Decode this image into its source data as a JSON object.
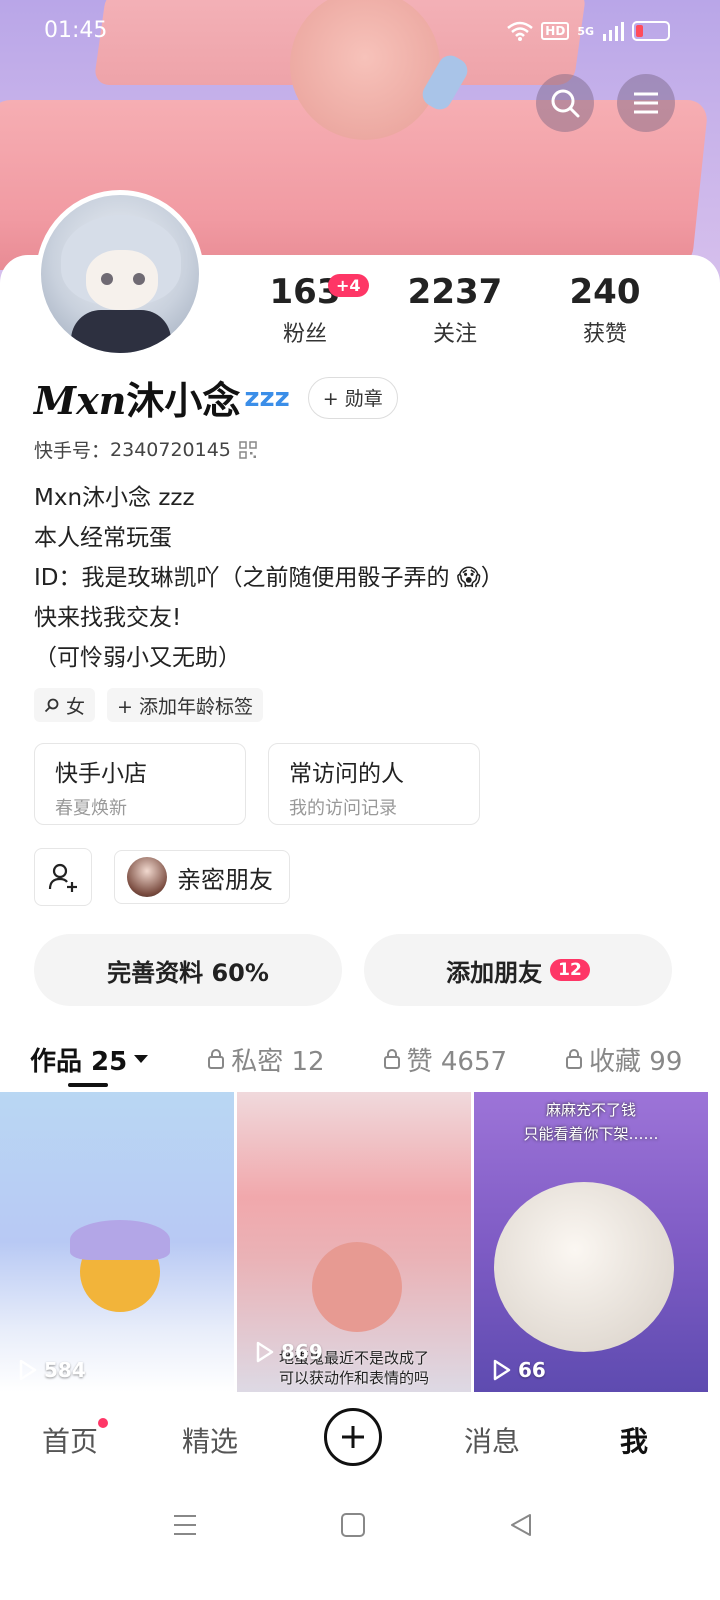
{
  "status_bar": {
    "time": "01:45",
    "hd": "HD",
    "network": "5G"
  },
  "profile": {
    "stats": [
      {
        "value": "163",
        "label": "粉丝",
        "badge": "+4"
      },
      {
        "value": "2237",
        "label": "关注"
      },
      {
        "value": "240",
        "label": "获赞"
      }
    ],
    "name_script": "Mxn",
    "name": "沐小念",
    "name_suffix": "zzz",
    "medal_button": "+ 勋章",
    "kuaishou_id_label": "快手号：",
    "kuaishou_id": "2340720145",
    "bio_lines": [
      "Mxn沐小念 zzz",
      "本人经常玩蛋",
      "ID：我是玫琳凯吖（之前随便用骰子弄的 😱）",
      "快来找我交友!",
      "（可怜弱小又无助）"
    ],
    "tags": [
      {
        "icon": "female-icon",
        "text": "女"
      },
      {
        "icon": "plus-icon",
        "text": "+ 添加年龄标签"
      }
    ]
  },
  "shortcuts": [
    {
      "title": "快手小店",
      "subtitle": "春夏焕新"
    },
    {
      "title": "常访问的人",
      "subtitle": "我的访问记录"
    }
  ],
  "close_friends_label": "亲密朋友",
  "actions": {
    "complete_profile": "完善资料 60%",
    "add_friends": "添加朋友",
    "add_friends_badge": "12"
  },
  "tabs": [
    {
      "label": "作品 25",
      "active": true
    },
    {
      "label": "私密 12",
      "locked": true
    },
    {
      "label": "赞 4657",
      "locked": true
    },
    {
      "label": "收藏 99",
      "locked": true
    }
  ],
  "videos": [
    {
      "plays": "584",
      "caption": ""
    },
    {
      "plays": "869",
      "caption": "地蛋鬼最近不是改成了\n可以获动作和表情的吗"
    },
    {
      "plays": "66",
      "caption": "麻麻充不了钱\n只能看着你下架……"
    }
  ],
  "bottom_nav": [
    {
      "label": "首页",
      "dot": true
    },
    {
      "label": "精选"
    },
    {
      "label": "消息"
    },
    {
      "label": "我",
      "active": true
    }
  ],
  "colors": {
    "accent": "#fe3666",
    "zz_blue": "#3b8ee8"
  }
}
